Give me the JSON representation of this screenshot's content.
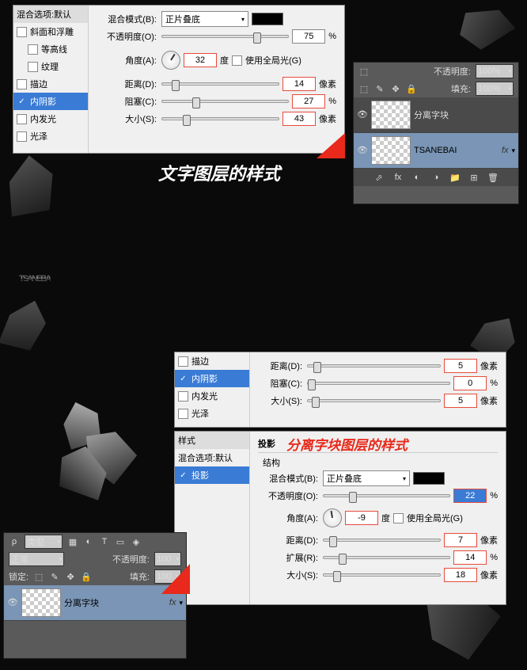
{
  "topPanel": {
    "header": "混合选项:默认",
    "styles": {
      "bevel": "斜面和浮雕",
      "contour": "等高线",
      "texture": "纹理",
      "stroke": "描边",
      "innerShadow": "内阴影",
      "innerGlow": "内发光",
      "satin": "光泽"
    },
    "blendModeLabel": "混合模式(B):",
    "blendModeValue": "正片叠底",
    "opacityLabel": "不透明度(O):",
    "opacityValue": "75",
    "percent": "%",
    "angleLabel": "角度(A):",
    "angleValue": "32",
    "deg": "度",
    "globalLight": "使用全局光(G)",
    "distanceLabel": "距离(D):",
    "distanceValue": "14",
    "px": "像素",
    "chokeLabel": "阻塞(C):",
    "chokeValue": "27",
    "sizeLabel": "大小(S):",
    "sizeValue": "43"
  },
  "caption1": "文字图层的样式",
  "bigWord": "TSANEBAI",
  "rightLayers": {
    "opacityLabel": "不透明度:",
    "opacityValue": "100%",
    "fillLabel": "填充:",
    "fillValue": "100%",
    "layer1": "分离字块",
    "layer2": "TSANEBAI",
    "fxBadge": "fx"
  },
  "midPanel": {
    "styles": {
      "stroke": "描边",
      "innerShadow": "内阴影",
      "innerGlow": "内发光",
      "satin": "光泽"
    },
    "distanceLabel": "距离(D):",
    "distanceValue": "5",
    "px": "像素",
    "chokeLabel": "阻塞(C):",
    "chokeValue": "0",
    "percent": "%",
    "sizeLabel": "大小(S):",
    "sizeValue": "5"
  },
  "caption2": "分离字块图层的样式",
  "shadowPanel": {
    "stylesHeader": "样式",
    "blendDefault": "混合选项:默认",
    "dropShadow": "投影",
    "sectionHeader": "投影",
    "structure": "结构",
    "blendModeLabel": "混合模式(B):",
    "blendModeValue": "正片叠底",
    "opacityLabel": "不透明度(O):",
    "opacityValue": "22",
    "percent": "%",
    "angleLabel": "角度(A):",
    "angleValue": "-9",
    "deg": "度",
    "globalLight": "使用全局光(G)",
    "distanceLabel": "距离(D):",
    "distanceValue": "7",
    "px": "像素",
    "spreadLabel": "扩展(R):",
    "spreadValue": "14",
    "sizeLabel": "大小(S):",
    "sizeValue": "18"
  },
  "bottomLayers": {
    "kindLabel": "类型",
    "normal": "正常",
    "opacityLabel": "不透明度:",
    "opacityValue": "100",
    "lockLabel": "锁定:",
    "fillLabel": "填充:",
    "fillValue": "100",
    "layer": "分离字块",
    "fxBadge": "fx"
  }
}
